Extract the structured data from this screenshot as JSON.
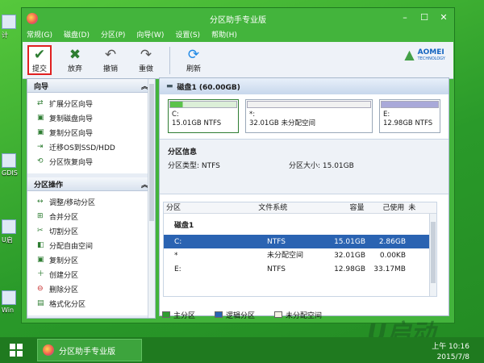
{
  "window": {
    "title": "分区助手专业版"
  },
  "menu": [
    "常规(G)",
    "磁盘(D)",
    "分区(P)",
    "向导(W)",
    "设置(S)",
    "帮助(H)"
  ],
  "toolbar": {
    "commit": "提交",
    "discard": "放弃",
    "undo": "撤销",
    "redo": "重做",
    "refresh": "刷新",
    "brand": "AOMEI",
    "brand_sub": "TECHNOLOGY"
  },
  "wizards": {
    "title": "向导",
    "items": [
      "扩展分区向导",
      "复制磁盘向导",
      "复制分区向导",
      "迁移OS到SSD/HDD",
      "分区恢复向导"
    ]
  },
  "operations": {
    "title": "分区操作",
    "items": [
      "调整/移动分区",
      "合并分区",
      "切割分区",
      "分配自由空间",
      "复制分区",
      "创建分区",
      "删除分区",
      "格式化分区"
    ]
  },
  "disk": {
    "label": "磁盘1 (60.00GB)",
    "partitions": [
      {
        "name": "C:",
        "detail": "15.01GB NTFS",
        "fill": 0.19
      },
      {
        "name": "*:",
        "detail": "32.01GB 未分配空间",
        "fill": 0.0
      },
      {
        "name": "E:",
        "detail": "12.98GB NTFS",
        "fill": 0.0
      }
    ]
  },
  "info": {
    "title": "分区信息",
    "type_label": "分区类型: NTFS",
    "size_label": "分区大小: 15.01GB"
  },
  "table": {
    "headers": [
      "分区",
      "文件系统",
      "容量",
      "己使用",
      "未"
    ],
    "group": "磁盘1",
    "rows": [
      [
        "C:",
        "NTFS",
        "15.01GB",
        "2.86GB"
      ],
      [
        "*",
        "未分配空间",
        "32.01GB",
        "0.00KB"
      ],
      [
        "E:",
        "NTFS",
        "12.98GB",
        "33.17MB"
      ]
    ]
  },
  "legend": [
    "主分区",
    "逻辑分区",
    "未分配空间"
  ],
  "colors": {
    "primary": "#2e9e2e",
    "logical": "#2a63b2",
    "unalloc": "#f6f1e6",
    "selection": "#2a63b2"
  },
  "taskbar": {
    "app": "分区助手专业版",
    "time": "上午 10:16",
    "date": "2015/7/8"
  },
  "desktop": [
    "计",
    "GDIS",
    "U启",
    "Win"
  ]
}
